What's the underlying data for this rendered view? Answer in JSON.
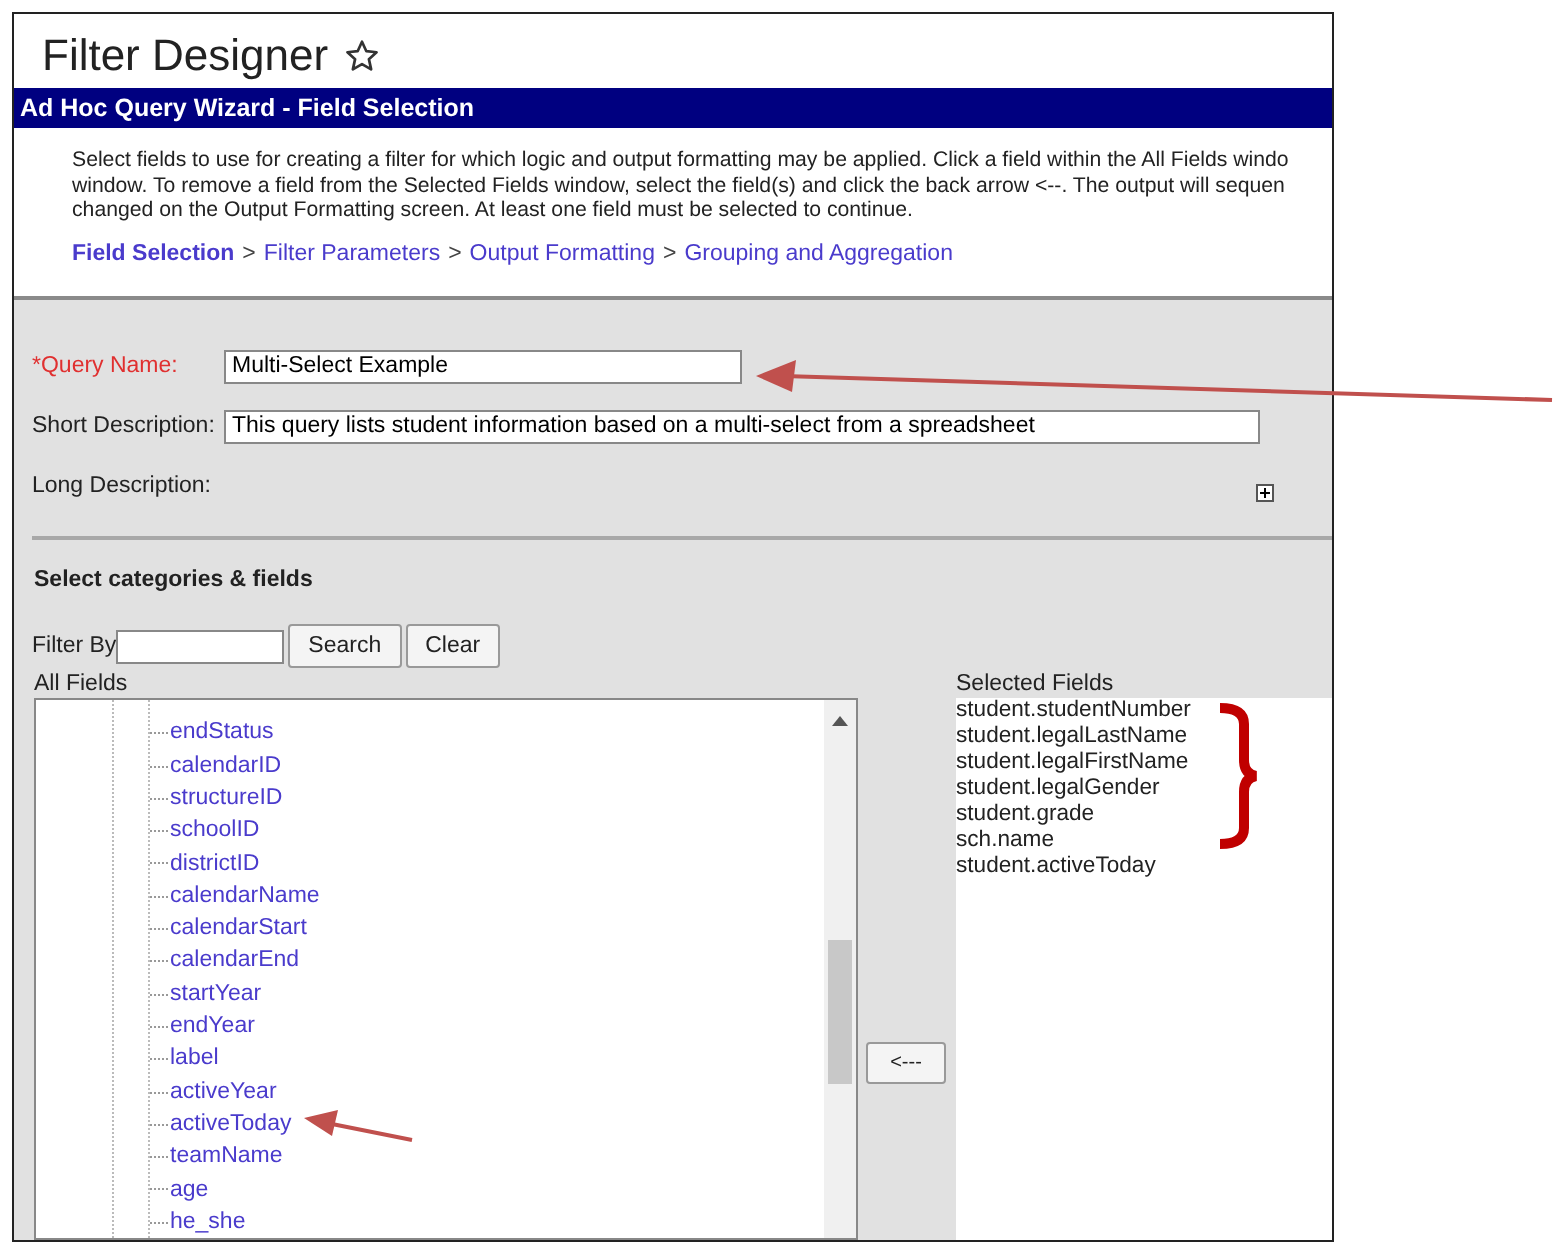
{
  "page": {
    "title": "Filter Designer"
  },
  "wizard": {
    "title": "Ad Hoc Query Wizard - Field Selection",
    "intro": [
      "Select fields to use for creating a filter for which logic and output formatting may be applied. Click a field within the All Fields windo",
      "window. To remove a field from the Selected Fields window, select the field(s) and click the back arrow <--. The output will sequen",
      "changed on the Output Formatting screen. At least one field must be selected to continue."
    ],
    "breadcrumb_separator": ">",
    "breadcrumbs": [
      {
        "label": "Field Selection",
        "selected": true
      },
      {
        "label": "Filter Parameters",
        "selected": false
      },
      {
        "label": "Output Formatting",
        "selected": false
      },
      {
        "label": "Grouping and Aggregation",
        "selected": false
      }
    ]
  },
  "form": {
    "query_name": {
      "label": "*Query Name:",
      "value": "Multi-Select Example",
      "required": true
    },
    "short_description": {
      "label": "Short Description:",
      "value": "This query lists student information based on a multi-select from a spreadsheet",
      "required": false
    },
    "long_description": {
      "label": "Long Description:",
      "expanded": false
    }
  },
  "fields": {
    "heading": "Select categories & fields",
    "filter_label": "Filter By",
    "search_button": "Search",
    "clear_button": "Clear",
    "all_fields_label": "All Fields",
    "all_fields": [
      "endStatus",
      "calendarID",
      "structureID",
      "schoolID",
      "districtID",
      "calendarName",
      "calendarStart",
      "calendarEnd",
      "startYear",
      "endYear",
      "label",
      "activeYear",
      "activeToday",
      "teamName",
      "age",
      "he_she"
    ],
    "back_button": "<---",
    "selected_fields_label": "Selected Fields",
    "selected_fields": [
      "student.studentNumber",
      "student.legalLastName",
      "student.legalFirstName",
      "student.legalGender",
      "student.grade",
      "sch.name",
      "student.activeToday"
    ]
  }
}
